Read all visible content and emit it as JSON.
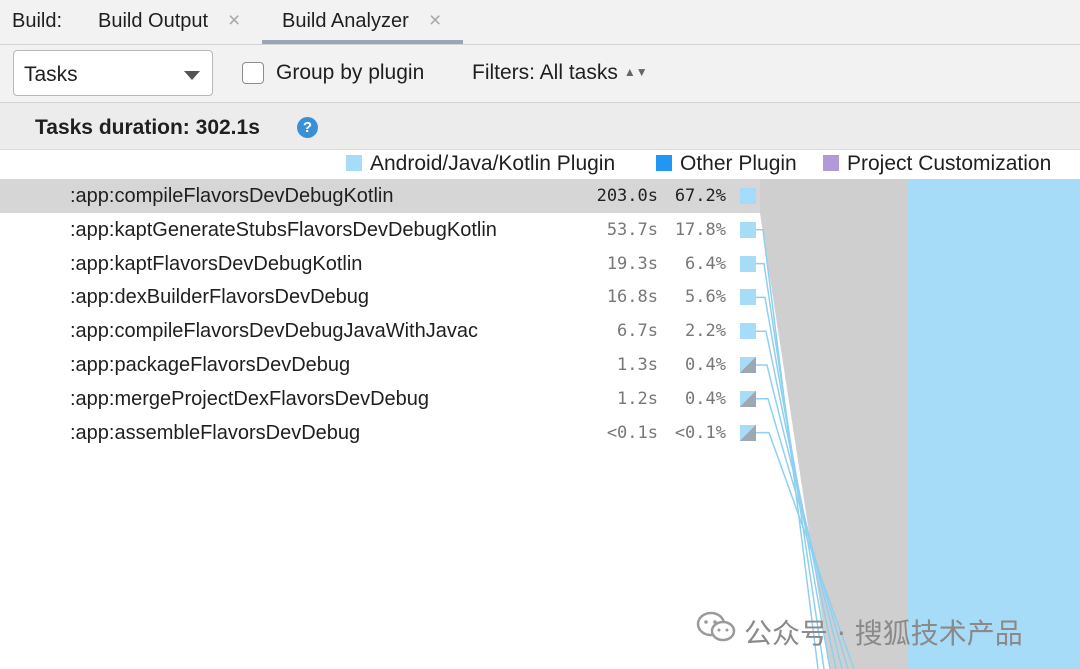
{
  "tabs": {
    "prefix": "Build:",
    "items": [
      {
        "label": "Build Output",
        "close": "×",
        "active": false
      },
      {
        "label": "Build Analyzer",
        "close": "×",
        "active": true
      }
    ]
  },
  "toolbar": {
    "view_select": "Tasks",
    "group_by_plugin_label": "Group by plugin",
    "group_by_plugin_checked": false,
    "filters_label": "Filters: All tasks"
  },
  "summary": {
    "title": "Tasks duration: 302.1s",
    "help_icon": "?"
  },
  "legend": [
    {
      "label": "Android/Java/Kotlin Plugin",
      "color": "#a6dcf7"
    },
    {
      "label": "Other Plugin",
      "color": "#2196f3"
    },
    {
      "label": "Project Customization",
      "color": "#b19ad9"
    }
  ],
  "tasks": [
    {
      "name": ":app:compileFlavorsDevDebugKotlin",
      "duration": "203.0s",
      "percent": "67.2%",
      "selected": true,
      "swatch": "solid"
    },
    {
      "name": ":app:kaptGenerateStubsFlavorsDevDebugKotlin",
      "duration": "53.7s",
      "percent": "17.8%",
      "selected": false,
      "swatch": "solid"
    },
    {
      "name": ":app:kaptFlavorsDevDebugKotlin",
      "duration": "19.3s",
      "percent": "6.4%",
      "selected": false,
      "swatch": "solid"
    },
    {
      "name": ":app:dexBuilderFlavorsDevDebug",
      "duration": "16.8s",
      "percent": "5.6%",
      "selected": false,
      "swatch": "solid"
    },
    {
      "name": ":app:compileFlavorsDevDebugJavaWithJavac",
      "duration": "6.7s",
      "percent": "2.2%",
      "selected": false,
      "swatch": "solid"
    },
    {
      "name": ":app:packageFlavorsDevDebug",
      "duration": "1.3s",
      "percent": "0.4%",
      "selected": false,
      "swatch": "diag"
    },
    {
      "name": ":app:mergeProjectDexFlavorsDevDebug",
      "duration": "1.2s",
      "percent": "0.4%",
      "selected": false,
      "swatch": "diag"
    },
    {
      "name": ":app:assembleFlavorsDevDebug",
      "duration": "<0.1s",
      "percent": "<0.1%",
      "selected": false,
      "swatch": "diag"
    }
  ],
  "watermark": {
    "text": "公众号 · 搜狐技术产品"
  },
  "colors": {
    "accent_blue": "#3b8fd4",
    "plugin_android": "#a6dcf7",
    "selection_grey": "#d6d6d6"
  }
}
